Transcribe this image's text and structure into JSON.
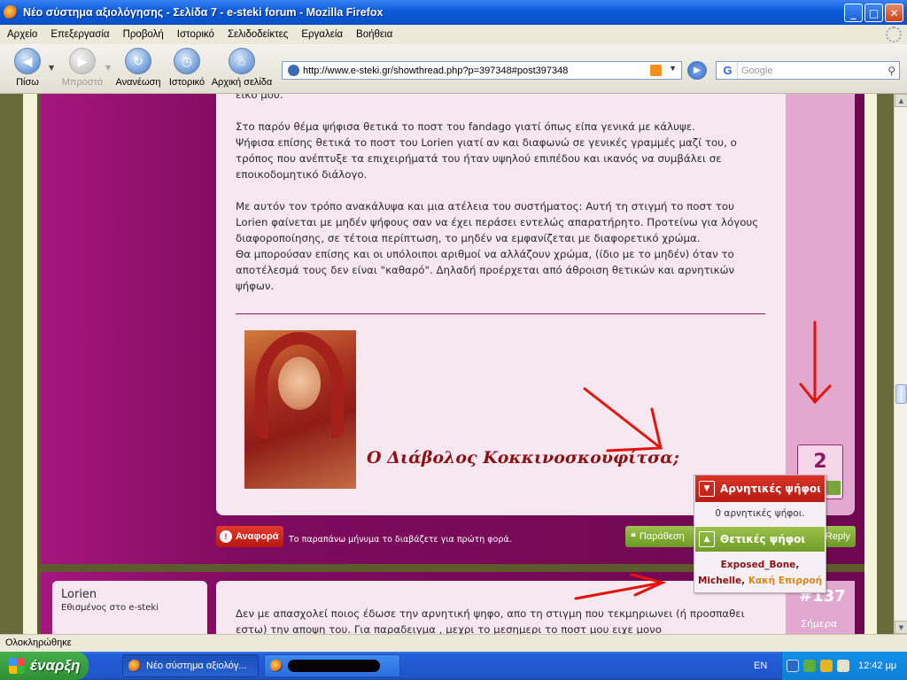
{
  "window": {
    "title": "Νέο σύστημα αξιολόγησης - Σελίδα 7 - e-steki forum - Mozilla Firefox",
    "buttons": {
      "minimize": "_",
      "maximize": "□",
      "close": "✕"
    }
  },
  "menu": [
    "Αρχείο",
    "Επεξεργασία",
    "Προβολή",
    "Ιστορικό",
    "Σελιδοδείκτες",
    "Εργαλεία",
    "Βοήθεια"
  ],
  "nav": {
    "back": "Πίσω",
    "forward": "Μπροστά",
    "reload": "Ανανέωση",
    "history": "Ιστορικό",
    "home": "Αρχική σελίδα",
    "url": "http://www.e-steki.gr/showthread.php?p=397348#post397348",
    "search_placeholder": "Google",
    "search_engine_icon": "G"
  },
  "post": {
    "partial_top": "είκο μου.",
    "paragraphs": [
      "Στο παρόν θέμα ψήφισα θετικά το ποστ του fandago γιατί όπως είπα γενικά με κάλυψε.",
      "Ψήφισα επίσης θετικά το ποστ του Lorien γιατί αν και διαφωνώ σε γενικές γραμμές μαζί του, ο τρόπος που ανέπτυξε τα επιχειρήματά του ήταν υψηλού επιπέδου και ικανός να συμβάλει σε εποικοδομητικό διάλογο.",
      "Με αυτόν τον τρόπο ανακάλυψα και μια ατέλεια του συστήματος: Αυτή τη στιγμή το ποστ του Lorien φαίνεται με μηδέν ψήφους σαν να έχει περάσει εντελώς απαρατήρητο. Προτείνω για λόγους διαφοροποίησης, σε τέτοια περίπτωση, το μηδέν να εμφανίζεται με διαφορετικό χρώμα.",
      "Θα μπορούσαν επίσης και οι υπόλοιποι αριθμοί να αλλάζουν χρώμα, (ίδιο με το μηδέν) όταν το αποτέλεσμά τους δεν είναι \"καθαρό\". Δηλαδή προέρχεται από άθροιση θετικών και αρνητικών ψήφων."
    ],
    "signature_text": "Ο Διάβολος Κοκκινοσκουφίτσα;",
    "vote_count": "2",
    "report_label": "Αναφορά",
    "first_read": "Το παραπάνω μήνυμα το διαβάζετε για πρώτη φορά.",
    "quote_label": "Παράθεση",
    "reply_label": "Reply"
  },
  "popup": {
    "negative_title": "Αρνητικές ψήφοι",
    "negative_text": "0 αρνητικές ψήφοι.",
    "positive_title": "Θετικές ψήφοι",
    "voters": [
      "Exposed_Bone",
      "Michelle",
      "Κακή Επιρροή"
    ],
    "sep": ","
  },
  "next_post": {
    "username": "Lorien",
    "rank": "Εθισμένος στο e-steki",
    "text": "Δεν με απασχολεί ποιος έδωσε την αρνητική ψηφο, απο τη στιγμη που τεκμηριωνει (ή προσπαθει εστω) την αποψη του. Για παραδειγμα , μεχρι το μεσημερι το ποστ μου ειχε μονο",
    "number": "#137",
    "date": "Σήμερα"
  },
  "status": "Ολοκληρώθηκε",
  "taskbar": {
    "start": "έναρξη",
    "task1": "Νέο σύστημα αξιολόγ...",
    "lang": "EN",
    "clock": "12:42 μμ"
  },
  "colors": {
    "post_purple": "#7e0b5e",
    "post_body": "#f6e7f1",
    "negative_red": "#c11a12",
    "positive_green": "#7aa53a"
  }
}
